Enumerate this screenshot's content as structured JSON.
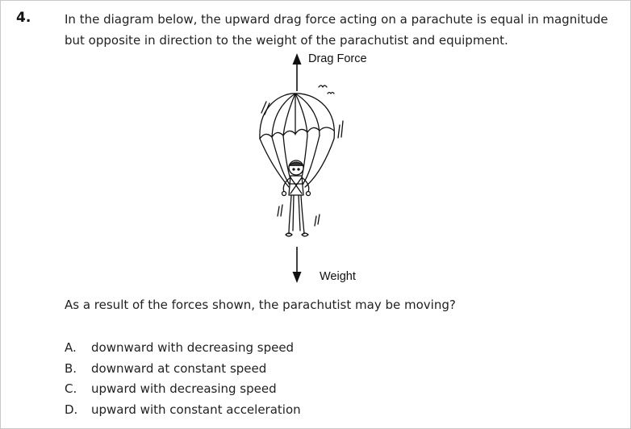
{
  "question": {
    "number": "4.",
    "stem": "In the diagram below, the upward drag force acting on a parachute is equal in magnitude but opposite in direction to the weight of the parachutist and equipment.",
    "prompt": "As a result of the forces shown, the parachutist may be moving?"
  },
  "diagram": {
    "drag_label": "Drag Force",
    "weight_label": "Weight",
    "parachutist_icon": "parachutist-illustration",
    "arrow_up_icon": "arrow-up-icon",
    "arrow_down_icon": "arrow-down-icon"
  },
  "choices": [
    {
      "letter": "A.",
      "text": "downward with decreasing speed"
    },
    {
      "letter": "B.",
      "text": "downward at constant speed"
    },
    {
      "letter": "C.",
      "text": "upward with decreasing speed"
    },
    {
      "letter": "D.",
      "text": "upward with constant acceleration"
    }
  ],
  "colors": {
    "text": "#222222",
    "line": "#111111",
    "border": "#c9c9c9"
  }
}
